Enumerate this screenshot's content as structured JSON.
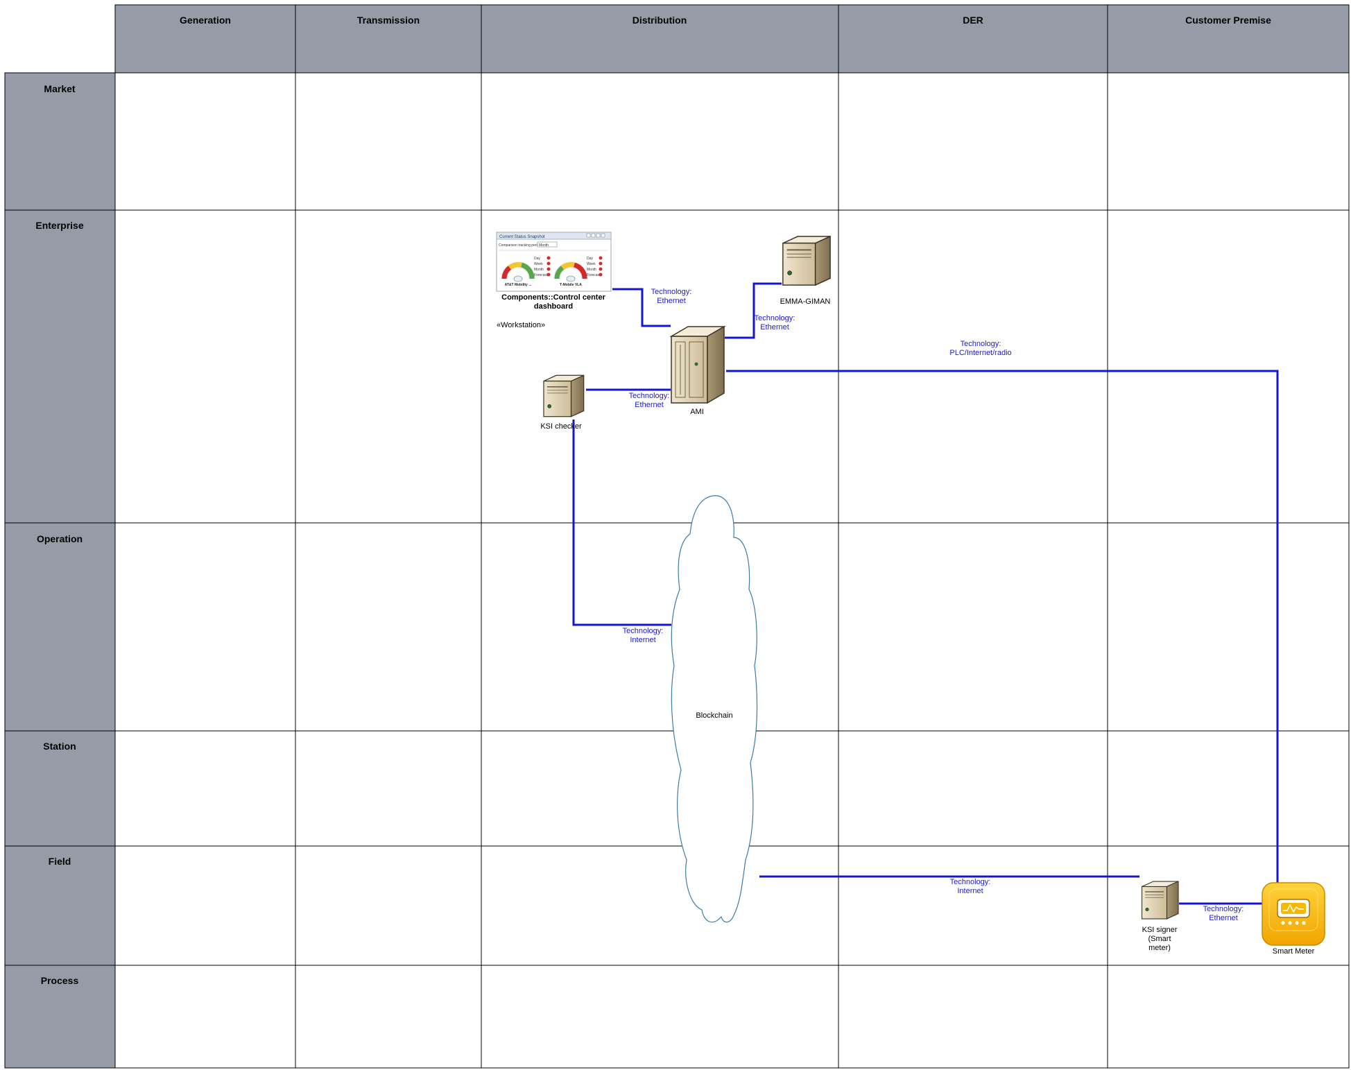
{
  "columns": [
    "Generation",
    "Transmission",
    "Distribution",
    "DER",
    "Customer Premise"
  ],
  "rows": [
    "Market",
    "Enterprise",
    "Operation",
    "Station",
    "Field",
    "Process"
  ],
  "colors": {
    "header_bg": "#959ca7",
    "grid_line": "#000000",
    "connector": "#1515d0",
    "tech_text": "#1a1ad6",
    "cloud_stroke": "#3a7ba8",
    "server_body": "#dfd3b6",
    "meter_yellow": "#f7b800"
  },
  "nodes": {
    "dashboard": {
      "icon": "dashboard-gauge-icon",
      "title": "Components::Control center dashboard",
      "title_line1": "Components::Control center",
      "title_line2": "dashboard",
      "stereotype": "«Workstation»",
      "window_title": "Current Status Snapshot",
      "period_label": "Comparison tracking period",
      "period_value": "Month",
      "gauge1": "AT&T Mobility ...",
      "gauge2": "T-Mobile VLA",
      "periods": [
        "Day",
        "Week",
        "Month",
        "Forecast"
      ]
    },
    "emma": {
      "icon": "server-icon",
      "label": "EMMA-GIMAN"
    },
    "ami": {
      "icon": "server-rack-icon",
      "label": "AMI"
    },
    "ksi_checker": {
      "icon": "server-icon",
      "label": "KSI checker"
    },
    "blockchain": {
      "icon": "cloud-icon",
      "label": "Blockchain"
    },
    "ksi_signer": {
      "icon": "server-icon",
      "label_lines": [
        "KSI signer",
        "(Smart",
        "meter)"
      ]
    },
    "smart_meter": {
      "icon": "smart-meter-icon",
      "label": "Smart Meter"
    }
  },
  "connections": [
    {
      "id": "dash-ami",
      "lines": [
        "Technology:",
        "Ethernet"
      ]
    },
    {
      "id": "ami-emma",
      "lines": [
        "Technology:",
        "Ethernet"
      ]
    },
    {
      "id": "ami-meter",
      "lines": [
        "Technology:",
        "PLC/Internet/radio"
      ]
    },
    {
      "id": "ksi-ami",
      "lines": [
        "Technology:",
        "Ethernet"
      ]
    },
    {
      "id": "ksi-cloud",
      "lines": [
        "Technology:",
        "Internet"
      ]
    },
    {
      "id": "cloud-signer",
      "lines": [
        "Technology:",
        "Internet"
      ]
    },
    {
      "id": "signer-meter",
      "lines": [
        "Technology:",
        "Ethernet"
      ]
    }
  ]
}
